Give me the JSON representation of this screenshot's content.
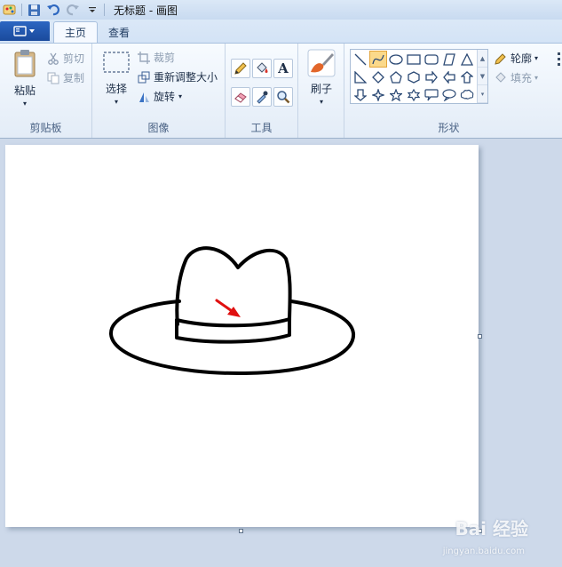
{
  "window": {
    "title": "无标题 - 画图"
  },
  "tabs": [
    {
      "label": "主页",
      "active": true
    },
    {
      "label": "查看",
      "active": false
    }
  ],
  "clipboard": {
    "paste_label": "粘贴",
    "cut_label": "剪切",
    "copy_label": "复制",
    "group_label": "剪贴板"
  },
  "image": {
    "select_label": "选择",
    "crop_label": "裁剪",
    "resize_label": "重新调整大小",
    "rotate_label": "旋转",
    "group_label": "图像"
  },
  "tools": {
    "group_label": "工具",
    "text_tool_glyph": "A"
  },
  "brushes": {
    "label": "刷子"
  },
  "shapes": {
    "group_label": "形状",
    "outline_label": "轮廓",
    "fill_label": "填充"
  },
  "watermark": {
    "text": "Bai 经验",
    "sub": "jingyan.baidu.com"
  },
  "colors": {
    "accent": "#2c66c2",
    "arrow": "#e01010",
    "selected_shape": "#fbd98a"
  }
}
